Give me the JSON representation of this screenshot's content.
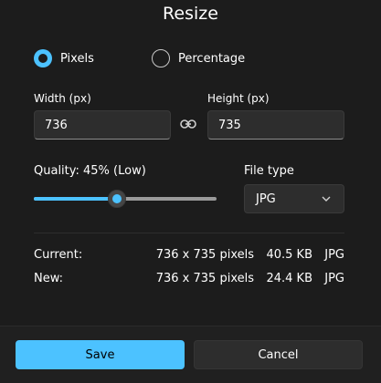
{
  "dialog": {
    "title": "Resize"
  },
  "mode": {
    "options": [
      {
        "label": "Pixels",
        "selected": true
      },
      {
        "label": "Percentage",
        "selected": false
      }
    ]
  },
  "width": {
    "label": "Width  (px)",
    "value": "736"
  },
  "height": {
    "label": "Height  (px)",
    "value": "735"
  },
  "quality": {
    "label": "Quality: 45% (Low)",
    "percent": 45
  },
  "file_type": {
    "label": "File type",
    "selected": "JPG"
  },
  "info": {
    "current": {
      "label": "Current:",
      "dimensions": "736 x 735 pixels",
      "size": "40.5 KB",
      "format": "JPG"
    },
    "new": {
      "label": "New:",
      "dimensions": "736 x 735 pixels",
      "size": "24.4 KB",
      "format": "JPG"
    }
  },
  "buttons": {
    "save": "Save",
    "cancel": "Cancel"
  },
  "colors": {
    "accent": "#4cc2ff",
    "background": "#1c1c1c"
  },
  "icons": {
    "aspect_lock": "link-icon",
    "dropdown": "chevron-down-icon"
  }
}
